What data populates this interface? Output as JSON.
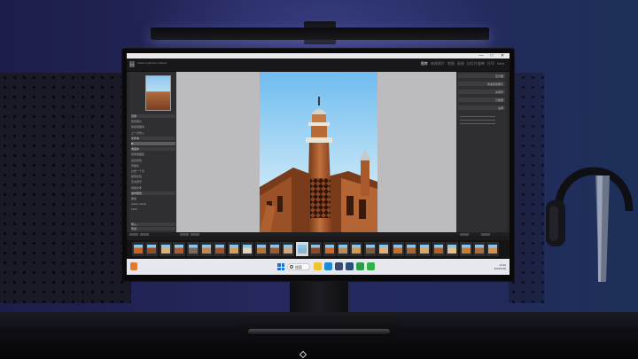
{
  "scene": {
    "description_colors": {
      "wall": "#23275c",
      "desk": "#0c0c10",
      "monitor": "#0a0a0c"
    }
  },
  "window": {
    "controls": [
      "—",
      "□",
      "✕"
    ],
    "app_title": "Adobe\nLightroom Classic"
  },
  "lightroom": {
    "modules": [
      "图库",
      "修改照片",
      "地图",
      "画册",
      "幻灯片放映",
      "打印",
      "Web"
    ],
    "active_module": "图库",
    "left_panel": {
      "rows": [
        {
          "label": "目录",
          "type": "header"
        },
        {
          "label": "所有照片",
          "type": "row"
        },
        {
          "label": "快捷收藏夹",
          "type": "row"
        },
        {
          "label": "上一次导入",
          "type": "row"
        },
        {
          "label": "文件夹",
          "type": "header"
        },
        {
          "label": "D:",
          "type": "sel"
        },
        {
          "label": "收藏夹",
          "type": "header"
        },
        {
          "label": "智能收藏集",
          "type": "row"
        },
        {
          "label": "最近修改",
          "type": "row"
        },
        {
          "label": "带星标",
          "type": "row"
        },
        {
          "label": "过去一个月",
          "type": "row"
        },
        {
          "label": "颜色标签",
          "type": "row"
        },
        {
          "label": "无关键字",
          "type": "row"
        },
        {
          "label": "视频文件",
          "type": "row"
        },
        {
          "label": "发布服务",
          "type": "header"
        },
        {
          "label": "硬盘",
          "type": "row"
        },
        {
          "label": "Adobe Stock",
          "type": "row"
        },
        {
          "label": "Flickr",
          "type": "row"
        }
      ],
      "buttons": [
        "导入...",
        "导出..."
      ]
    },
    "right_panel": {
      "rows": [
        "直方图",
        "快速修改照片",
        "关键字",
        "元数据",
        "注释"
      ],
      "buttons": [
        "同步",
        "同步设置"
      ]
    },
    "filmstrip": {
      "source_label": "上一次导入 / 28 张照片",
      "thumbnail_colors": [
        "#c9651f",
        "#8f4e2a",
        "#d9b27a",
        "#b05c2c",
        "#7a6a5c",
        "#c4874f",
        "#a0522d",
        "#d4a15a",
        "#e0d3c0",
        "#b3742f",
        "#9e5b32",
        "#cfa77a",
        "#88b7d8",
        "#8b4a23",
        "#c96b2a",
        "#b88b5c",
        "#d19a50",
        "#7e5a3c",
        "#e0b27a",
        "#c36f2e",
        "#a86632",
        "#d8a866",
        "#b45f2a",
        "#e3c08a",
        "#c77d3a",
        "#b06a3e",
        "#d39250"
      ],
      "selected_index": 12
    }
  },
  "taskbar": {
    "weather": "28°C",
    "search_placeholder": "搜索",
    "tray_time": "14:32",
    "tray_date": "2023/6/18",
    "apps": [
      "file-explorer",
      "edge",
      "store",
      "lightroom",
      "chrome",
      "wechat"
    ]
  }
}
